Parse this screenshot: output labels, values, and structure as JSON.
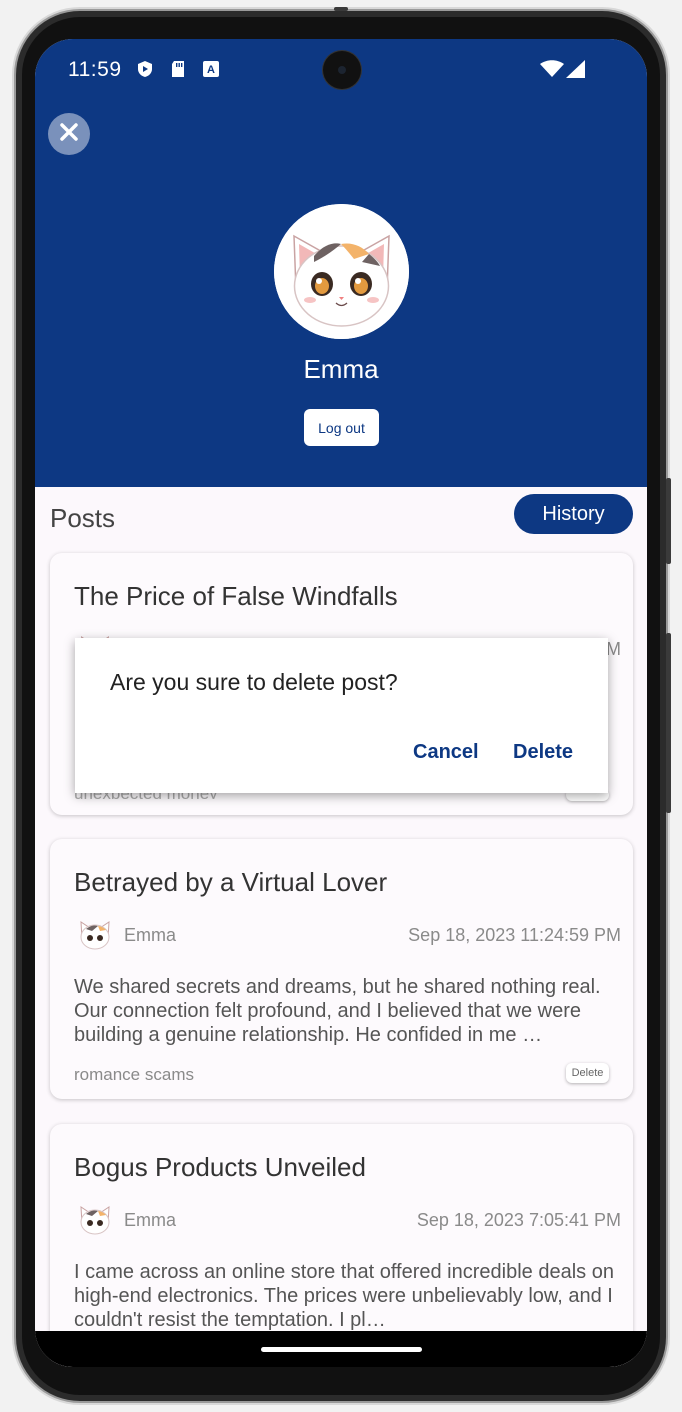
{
  "status_bar": {
    "time": "11:59",
    "icons": [
      "shield-icon",
      "sd-card-icon",
      "translate-icon",
      "wifi-icon",
      "cell-signal-icon"
    ]
  },
  "profile": {
    "username": "Emma",
    "logout_label": "Log out",
    "avatar": "cat-avatar"
  },
  "posts_section": {
    "title": "Posts",
    "history_label": "History"
  },
  "posts": [
    {
      "title": "The Price of False Windfalls",
      "author": "",
      "date": "M",
      "body": "",
      "tag": "unexpected money",
      "delete_label": ""
    },
    {
      "title": "Betrayed by a Virtual Lover",
      "author": "Emma",
      "date": "Sep 18, 2023 11:24:59 PM",
      "body": "We shared secrets and dreams, but he shared nothing real. Our connection felt profound, and I believed that we were building a genuine relationship. He confided in me …",
      "tag": "romance scams",
      "delete_label": "Delete"
    },
    {
      "title": "Bogus Products Unveiled",
      "author": "Emma",
      "date": "Sep 18, 2023 7:05:41 PM",
      "body": "I came across an online store that offered incredible deals on high-end electronics. The prices were unbelievably low, and I couldn't resist the temptation. I pl…",
      "tag": "",
      "delete_label": ""
    }
  ],
  "dialog": {
    "message": "Are you sure to delete post?",
    "cancel_label": "Cancel",
    "delete_label": "Delete"
  },
  "colors": {
    "primary": "#0d3883",
    "background": "#fcf8fc",
    "card": "#fdfafd"
  }
}
